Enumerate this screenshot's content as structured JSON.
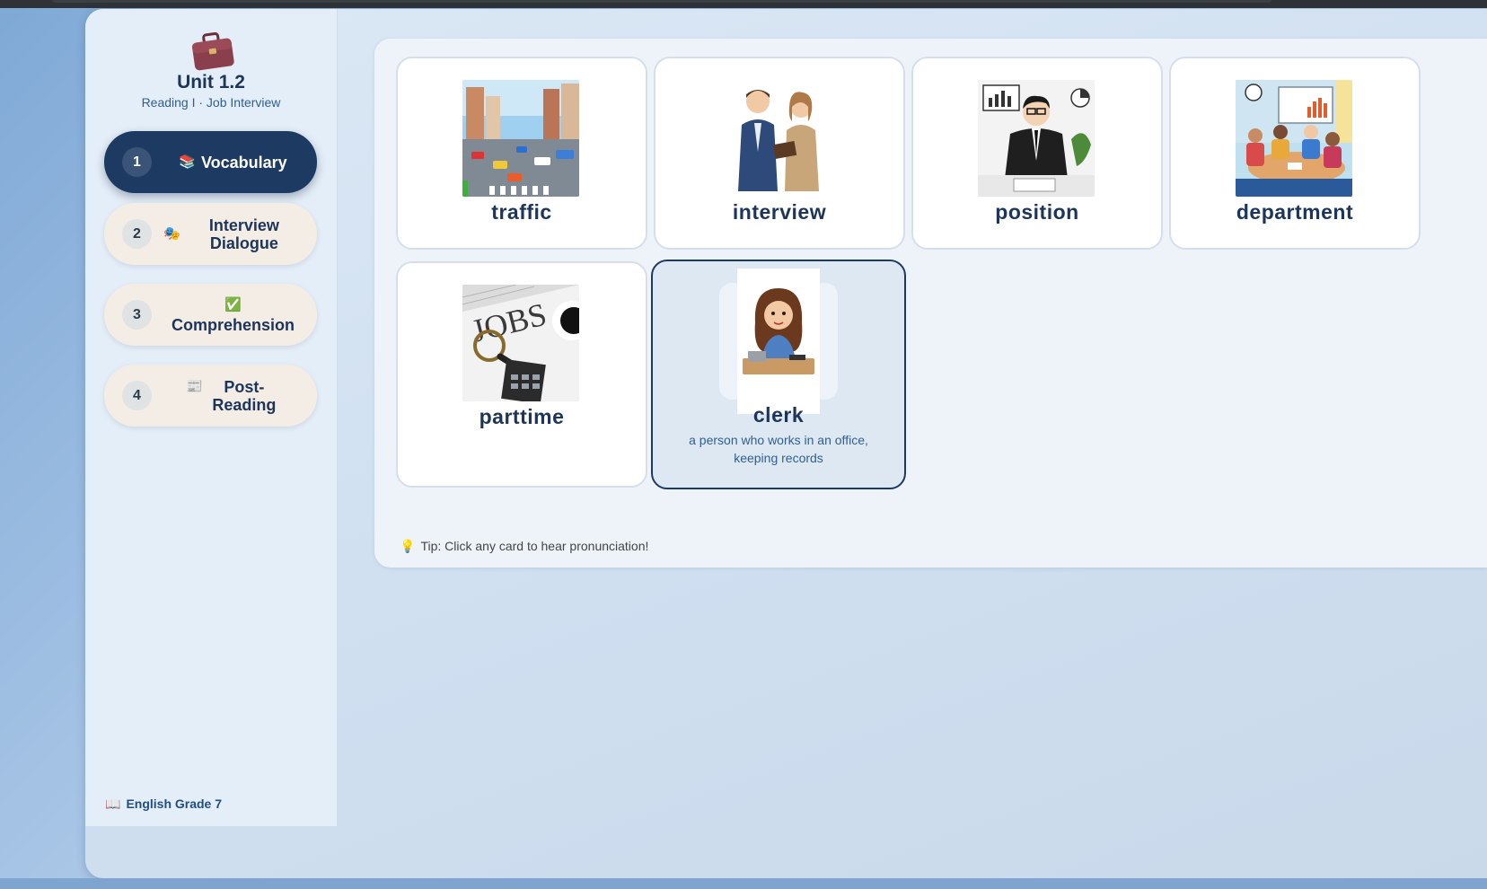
{
  "unit": {
    "title": "Unit 1.2",
    "subtitle": "Reading I · Job Interview",
    "icon": "briefcase-icon"
  },
  "nav": [
    {
      "num": "1",
      "icon": "📚",
      "icon_name": "books-icon",
      "label": "Vocabulary",
      "active": true
    },
    {
      "num": "2",
      "icon": "🎭",
      "icon_name": "theater-masks-icon",
      "label": "Interview Dialogue",
      "active": false
    },
    {
      "num": "3",
      "icon": "✅",
      "icon_name": "check-mark-icon",
      "label": "Comprehension",
      "active": false
    },
    {
      "num": "4",
      "icon": "📰",
      "icon_name": "newspaper-icon",
      "label": "Post-Reading",
      "active": false
    }
  ],
  "footer": {
    "icon": "📖",
    "label": "English Grade 7"
  },
  "cards": [
    {
      "word": "traffic",
      "image": "city-traffic-illustration"
    },
    {
      "word": "interview",
      "image": "two-people-interview-illustration"
    },
    {
      "word": "position",
      "image": "businessman-at-desk-illustration"
    },
    {
      "word": "department",
      "image": "office-team-meeting-illustration"
    },
    {
      "word": "parttime",
      "image": "jobs-newspaper-magnifier-illustration"
    },
    {
      "word": "clerk",
      "image": "office-clerk-woman-illustration",
      "definition": "a person who works in an office, keeping records",
      "selected": true
    }
  ],
  "tip": {
    "icon": "💡",
    "text": "Tip: Click any card to hear pronunciation!"
  },
  "colors": {
    "navy": "#1d3a63",
    "accent_text": "#2f5f90",
    "nav_idle_bg": "#f3ede6",
    "selected_card_bg": "#dde8f3"
  }
}
